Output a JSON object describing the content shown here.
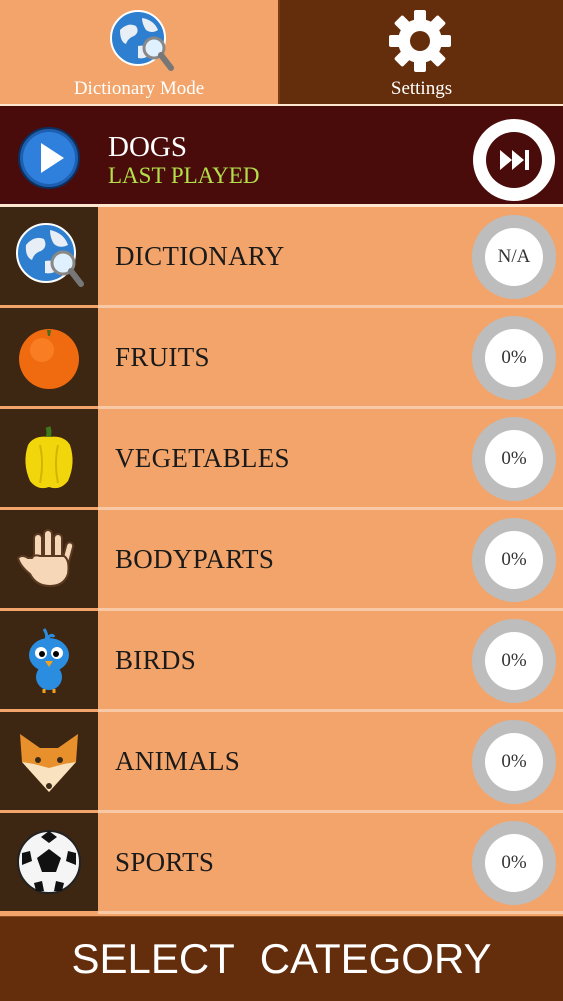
{
  "tabs": {
    "dictionary": {
      "label": "Dictionary Mode",
      "icon": "globe-search-icon"
    },
    "settings": {
      "label": "Settings",
      "icon": "gear-icon"
    }
  },
  "last_played": {
    "title": "DOGS",
    "subtitle": "LAST PLAYED",
    "play_icon": "play-icon",
    "skip_icon": "fast-forward-icon"
  },
  "categories": [
    {
      "label": "DICTIONARY",
      "progress": "N/A",
      "icon": "globe-search-icon"
    },
    {
      "label": "FRUITS",
      "progress": "0%",
      "icon": "orange-icon"
    },
    {
      "label": "VEGETABLES",
      "progress": "0%",
      "icon": "bell-pepper-icon"
    },
    {
      "label": "BODYPARTS",
      "progress": "0%",
      "icon": "hand-icon"
    },
    {
      "label": "BIRDS",
      "progress": "0%",
      "icon": "bird-icon"
    },
    {
      "label": "ANIMALS",
      "progress": "0%",
      "icon": "fox-icon"
    },
    {
      "label": "SPORTS",
      "progress": "0%",
      "icon": "soccer-ball-icon"
    }
  ],
  "footer": {
    "title": "SELECT CATEGORY"
  },
  "colors": {
    "background": "#f2a46a",
    "dark_brown": "#642d0b",
    "banner": "#4a0c0b",
    "accent_green": "#b3e04a"
  }
}
